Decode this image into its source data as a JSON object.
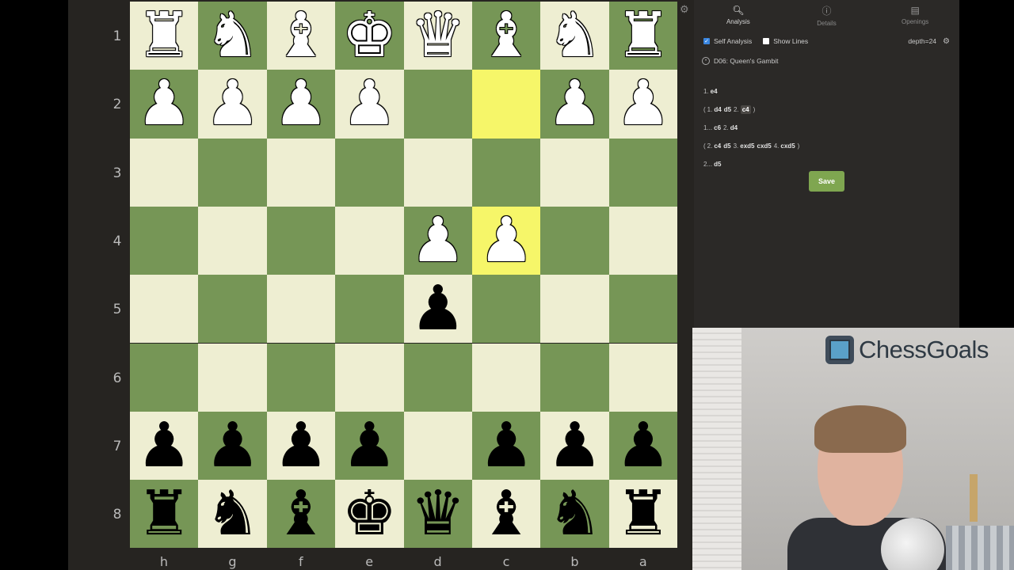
{
  "ranks": [
    "1",
    "2",
    "3",
    "4",
    "5",
    "6",
    "7",
    "8"
  ],
  "files": [
    "h",
    "g",
    "f",
    "e",
    "d",
    "c",
    "b",
    "a"
  ],
  "board": [
    [
      "wR",
      "wN",
      "wB",
      "wK",
      "wQ",
      "wB",
      "wN",
      "wR"
    ],
    [
      "wP",
      "wP",
      "wP",
      "wP",
      "",
      "",
      "wP",
      "wP"
    ],
    [
      "",
      "",
      "",
      "",
      "",
      "",
      "",
      ""
    ],
    [
      "",
      "",
      "",
      "",
      "wP",
      "wP",
      "",
      ""
    ],
    [
      "",
      "",
      "",
      "",
      "bP",
      "",
      "",
      ""
    ],
    [
      "",
      "",
      "",
      "",
      "",
      "",
      "",
      ""
    ],
    [
      "bP",
      "bP",
      "bP",
      "bP",
      "",
      "bP",
      "bP",
      "bP"
    ],
    [
      "bR",
      "bN",
      "bB",
      "bK",
      "bQ",
      "bB",
      "bN",
      "bR"
    ]
  ],
  "highlights": [
    [
      1,
      5
    ],
    [
      3,
      5
    ]
  ],
  "colors": {
    "light": "#eeeed2",
    "dark": "#769656",
    "highlight": "#f6f669",
    "accent": "#7fa650"
  },
  "panel": {
    "tabs": [
      {
        "label": "Analysis",
        "icon": "search-icon"
      },
      {
        "label": "Details",
        "icon": "info-icon"
      },
      {
        "label": "Openings",
        "icon": "book-icon"
      }
    ],
    "self_analysis_label": "Self Analysis",
    "self_analysis_checked": true,
    "show_lines_label": "Show Lines",
    "show_lines_checked": false,
    "depth": "depth=24",
    "opening": "D06: Queen's Gambit",
    "moves": [
      [
        {
          "t": "num",
          "v": "1."
        },
        {
          "t": "san",
          "v": "e4"
        }
      ],
      [
        {
          "t": "par",
          "v": "("
        },
        {
          "t": "num",
          "v": "1."
        },
        {
          "t": "san",
          "v": "d4"
        },
        {
          "t": "san",
          "v": "d5"
        },
        {
          "t": "num",
          "v": "2."
        },
        {
          "t": "cur",
          "v": "c4"
        },
        {
          "t": "par",
          "v": ")"
        }
      ],
      [
        {
          "t": "num",
          "v": "1..."
        },
        {
          "t": "san",
          "v": "c6"
        },
        {
          "t": "num",
          "v": "2."
        },
        {
          "t": "san",
          "v": "d4"
        }
      ],
      [
        {
          "t": "par",
          "v": "("
        },
        {
          "t": "num",
          "v": "2."
        },
        {
          "t": "san",
          "v": "c4"
        },
        {
          "t": "san",
          "v": "d5"
        },
        {
          "t": "num",
          "v": "3."
        },
        {
          "t": "san",
          "v": "exd5"
        },
        {
          "t": "san",
          "v": "cxd5"
        },
        {
          "t": "num",
          "v": "4."
        },
        {
          "t": "san",
          "v": "cxd5"
        },
        {
          "t": "par",
          "v": ")"
        }
      ],
      [
        {
          "t": "num",
          "v": "2..."
        },
        {
          "t": "san",
          "v": "d5"
        }
      ]
    ],
    "save_label": "Save"
  },
  "webcam": {
    "logo_text": "ChessGoals"
  }
}
